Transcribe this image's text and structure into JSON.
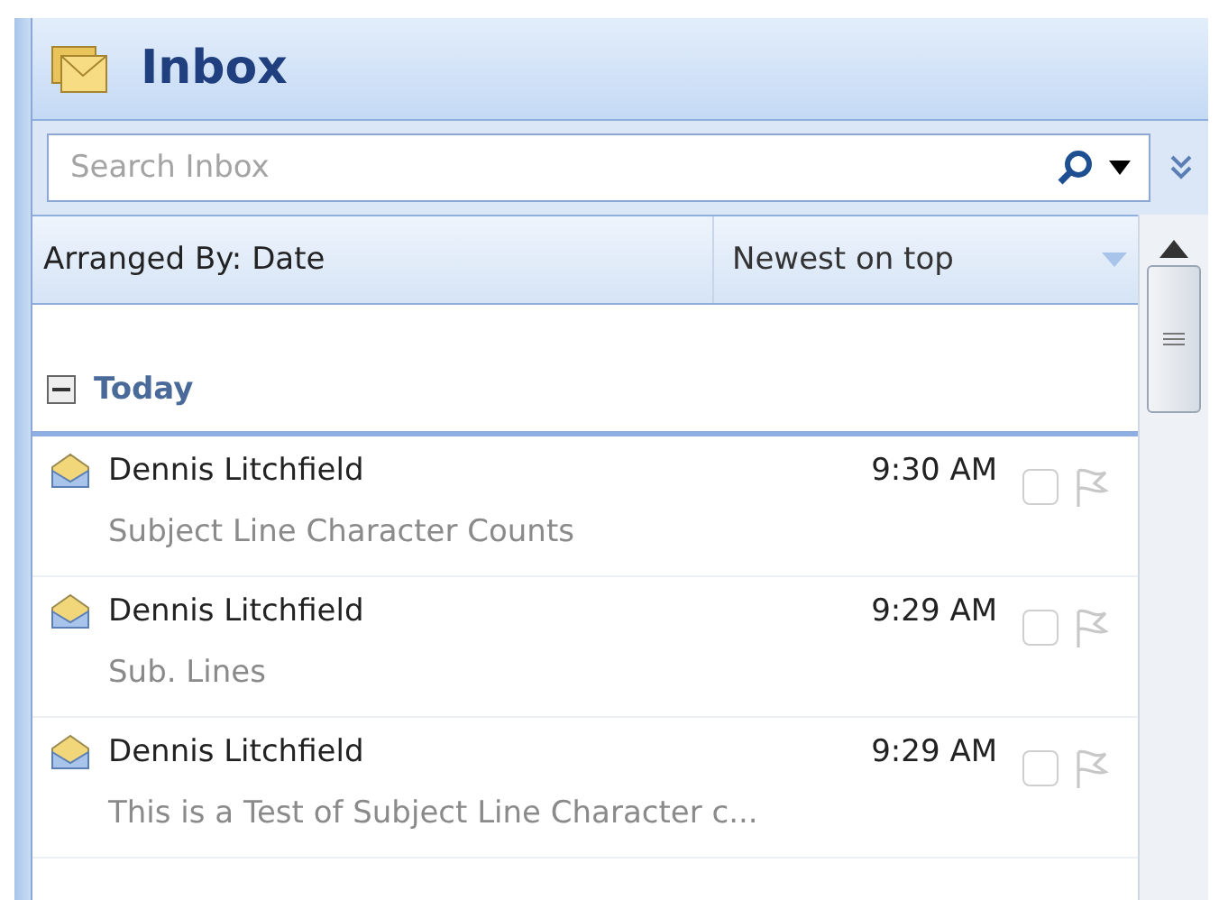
{
  "title": "Inbox",
  "search": {
    "placeholder": "Search Inbox"
  },
  "arrange": {
    "label": "Arranged By: Date",
    "order": "Newest on top"
  },
  "group": {
    "label": "Today",
    "expanded": true
  },
  "messages": [
    {
      "sender": "Dennis Litchfield",
      "time": "9:30 AM",
      "subject": "Subject Line Character Counts",
      "checked": false
    },
    {
      "sender": "Dennis Litchfield",
      "time": "9:29 AM",
      "subject": "Sub. Lines",
      "checked": false
    },
    {
      "sender": "Dennis Litchfield",
      "time": "9:29 AM",
      "subject": "This is a Test of Subject Line Character c...",
      "checked": false
    }
  ]
}
